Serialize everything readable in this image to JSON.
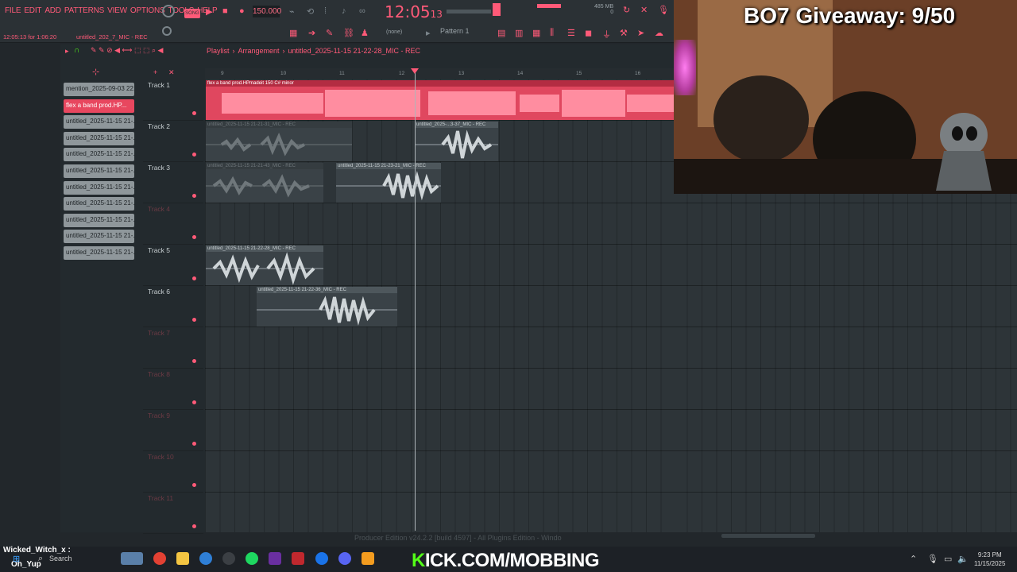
{
  "menu": [
    "FILE",
    "EDIT",
    "ADD",
    "PATTERNS",
    "VIEW",
    "OPTIONS",
    "TOOLS",
    "HELP"
  ],
  "hint_left": "12:05:13 for 1:06:20",
  "hint_right": "untitled_202_7_MIC - REC",
  "transport": {
    "mode": "SONG",
    "tempo": "150.000",
    "clock": "12:05",
    "clock_small": "13"
  },
  "memory": {
    "value": "485 MB",
    "sub": "0"
  },
  "pattern": "Pattern 1",
  "none_label": "(none)",
  "playlist": {
    "crumbs": [
      "Playlist",
      "Arrangement",
      "untitled_2025-11-15 21-22-28_MIC - REC"
    ],
    "picker": [
      {
        "label": "mention_2025-09-03 22...",
        "selected": false
      },
      {
        "label": "flex a band prod.HP...",
        "selected": true
      },
      {
        "label": "untitled_2025-11-15 21-...",
        "selected": false
      },
      {
        "label": "untitled_2025-11-15 21-...",
        "selected": false
      },
      {
        "label": "untitled_2025-11-15 21-...",
        "selected": false
      },
      {
        "label": "untitled_2025-11-15 21-...",
        "selected": false
      },
      {
        "label": "untitled_2025-11-15 21-...",
        "selected": false
      },
      {
        "label": "untitled_2025-11-15 21-...",
        "selected": false
      },
      {
        "label": "untitled_2025-11-15 21-...",
        "selected": false
      },
      {
        "label": "untitled_2025-11-15 21-...",
        "selected": false
      },
      {
        "label": "untitled_2025-11-15 21-...",
        "selected": false
      }
    ],
    "tracks": [
      "Track 1",
      "Track 2",
      "Track 3",
      "Track 4",
      "Track 5",
      "Track 6",
      "Track 7",
      "Track 8",
      "Track 9",
      "Track 10",
      "Track 11"
    ],
    "ruler": [
      "9",
      "10",
      "11",
      "12",
      "13",
      "14",
      "15",
      "16"
    ],
    "clips": [
      {
        "label": "flex a band prod.HPmadeit 150 C# minor"
      },
      {
        "label": "untitled_2025-11-15 21-21-31_MIC - REC"
      },
      {
        "label": "untitled_2025-...3-37_MIC - REC"
      },
      {
        "label": "untitled_2025-11-15 21-21-43_MIC - REC"
      },
      {
        "label": "untitled_2025-11-15 21-23-21_MIC - REC"
      },
      {
        "label": "untitled_2025-11-15 21-22-28_MIC - REC"
      },
      {
        "label": "untitled_2025-11-15 21-22-36_MIC - REC"
      }
    ]
  },
  "overlay": {
    "giveaway": "BO7 Giveaway: 9/50",
    "kick_k": "K",
    "kick_rest": "ICK.COM/MOBBING",
    "chat_user": "Wicked_Witch_x :",
    "chat_msg": "Oh_Yup",
    "status": "Producer Edition v24.2.2 [build 4597] - All Plugins Edition - Windo"
  },
  "taskbar": {
    "search": "Search",
    "time": "9:23 PM",
    "date": "11/15/2025"
  }
}
